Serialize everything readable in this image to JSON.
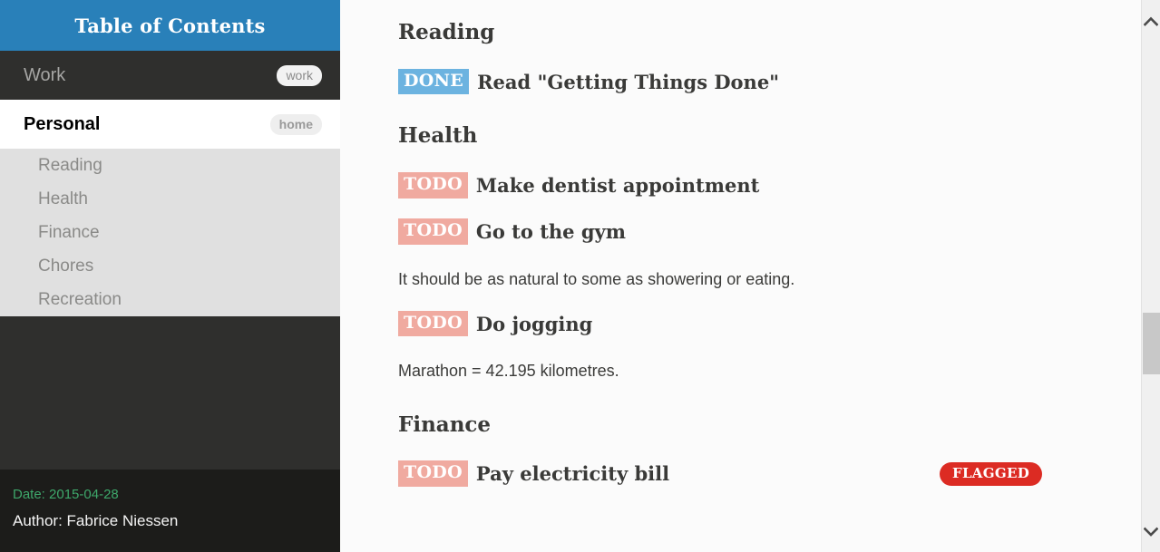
{
  "sidebar": {
    "header_title": "Table of Contents",
    "items": [
      {
        "label": "Work",
        "level": 1,
        "tag": "work",
        "active": false
      },
      {
        "label": "Personal",
        "level": 1,
        "tag": "home",
        "active": true
      },
      {
        "label": "Reading",
        "level": 2,
        "tag": "",
        "active": false
      },
      {
        "label": "Health",
        "level": 2,
        "tag": "",
        "active": false
      },
      {
        "label": "Finance",
        "level": 2,
        "tag": "",
        "active": false
      },
      {
        "label": "Chores",
        "level": 2,
        "tag": "",
        "active": false
      },
      {
        "label": "Recreation",
        "level": 2,
        "tag": "",
        "active": false
      }
    ],
    "footer": {
      "date": "Date: 2015-04-28",
      "author": "Author: Fabrice Niessen"
    }
  },
  "content": {
    "sections": [
      {
        "heading": "Reading",
        "tasks": [
          {
            "keyword": "DONE",
            "title": "Read \"Getting Things Done\"",
            "tag": ""
          }
        ],
        "notes": []
      },
      {
        "heading": "Health",
        "tasks": [
          {
            "keyword": "TODO",
            "title": "Make dentist appointment",
            "tag": ""
          },
          {
            "keyword": "TODO",
            "title": "Go to the gym",
            "tag": ""
          }
        ],
        "notes": [
          "It should be as natural to some as showering or eating."
        ]
      },
      {
        "heading": "Finance",
        "tasks": [
          {
            "keyword": "TODO",
            "title": "Do jogging",
            "tag": ""
          },
          {
            "keyword": "TODO",
            "title": "Pay electricity bill",
            "tag": "FLAGGED"
          }
        ],
        "notes": [
          "Marathon = 42.195 kilometres."
        ]
      }
    ],
    "body": {
      "h_reading": "Reading",
      "t_read_kw": "DONE",
      "t_read_title": "Read \"Getting Things Done\"",
      "h_health": "Health",
      "t_dentist_kw": "TODO",
      "t_dentist_title": "Make dentist appointment",
      "t_gym_kw": "TODO",
      "t_gym_title": "Go to the gym",
      "note_gym": "It should be as natural to some as showering or eating.",
      "t_jog_kw": "TODO",
      "t_jog_title": "Do jogging",
      "note_jog": "Marathon = 42.195 kilometres.",
      "h_finance": "Finance",
      "t_bill_kw": "TODO",
      "t_bill_title": "Pay electricity bill",
      "t_bill_tag": "FLAGGED"
    }
  },
  "scrollbar": {
    "up_icon": "chevron-up-icon",
    "down_icon": "chevron-down-icon"
  },
  "colors": {
    "header_blue": "#2980b9",
    "sidebar_dark": "#2f2f2d",
    "sidebar_footer": "#1c1c1a",
    "subitem_gray": "#e0e0e0",
    "done_badge": "#6cb3e0",
    "todo_badge": "#f0aaa0",
    "flagged_badge": "#dc2b23",
    "date_green": "#3ea86b",
    "content_bg": "#fbfbfb"
  }
}
